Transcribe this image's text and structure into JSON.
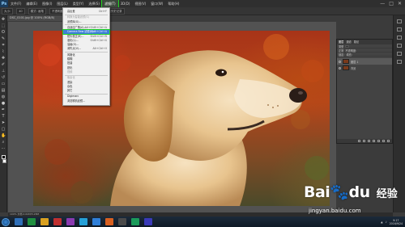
{
  "menubar": {
    "app_icon": "Ps",
    "items": [
      "文件(F)",
      "编辑(E)",
      "图像(I)",
      "图层(L)",
      "类型(Y)",
      "选择(S)",
      "滤镜(T)",
      "3D(D)",
      "视图(V)",
      "窗口(W)",
      "帮助(H)"
    ],
    "active_index": 6,
    "window_controls": [
      "—",
      "□",
      "✕"
    ]
  },
  "optbar": {
    "items": [
      "大小:",
      "40",
      "模式: 画笔",
      "不透明度: 100%",
      "流量: 100%",
      "抹到历史记录"
    ]
  },
  "doc_tab": "DSC_0101.jpg @ 100% (RGB/8)",
  "dropdown": {
    "items": [
      {
        "label": "高反差",
        "shortcut": "Ctrl+F",
        "disabled": false
      },
      {
        "label": "转换为智能滤镜(S)",
        "shortcut": "",
        "disabled": true
      },
      {
        "label": "滤镜库(G)...",
        "shortcut": "",
        "disabled": false
      },
      {
        "label": "自适应广角(A)...",
        "shortcut": "Alt+Shift+Ctrl+A",
        "disabled": false
      },
      {
        "label": "Camera Raw 滤镜(C)...",
        "shortcut": "Shift+Ctrl+A",
        "disabled": false
      },
      {
        "label": "镜头校正(R)...",
        "shortcut": "Shift+Ctrl+R",
        "disabled": false
      },
      {
        "label": "液化(L)...",
        "shortcut": "Shift+Ctrl+X",
        "disabled": false
      },
      {
        "label": "油画(O)...",
        "shortcut": "",
        "disabled": false
      },
      {
        "label": "消失点(V)...",
        "shortcut": "Alt+Ctrl+V",
        "disabled": false
      },
      {
        "label": "风格化",
        "shortcut": "",
        "disabled": false
      },
      {
        "label": "模糊",
        "shortcut": "",
        "disabled": false
      },
      {
        "label": "扭曲",
        "shortcut": "",
        "disabled": false
      },
      {
        "label": "锐化",
        "shortcut": "",
        "disabled": false
      },
      {
        "label": "视频",
        "shortcut": "",
        "disabled": true
      },
      {
        "label": "像素化",
        "shortcut": "",
        "disabled": true
      },
      {
        "label": "渲染",
        "shortcut": "",
        "disabled": false
      },
      {
        "label": "杂色",
        "shortcut": "",
        "disabled": false
      },
      {
        "label": "其它",
        "shortcut": "",
        "disabled": false
      },
      {
        "label": "Digimarc",
        "shortcut": "",
        "disabled": false
      },
      {
        "label": "浏览联机滤镜...",
        "shortcut": "",
        "disabled": false
      }
    ],
    "highlighted_index": 4
  },
  "layers_panel": {
    "tabs": [
      "图层",
      "通道",
      "路径"
    ],
    "kind_label": "类型",
    "blend_mode": "正常",
    "opacity_label": "不透明度:",
    "lock_label": "锁定:",
    "fill_label": "填充:",
    "layers": [
      "图层 1",
      "背景"
    ],
    "selected_index": 0
  },
  "status": "100%    文档:2.64M/5.28M",
  "taskbar": {
    "apps": [
      "#2f6fb8",
      "#1f8f3f",
      "#d8a020",
      "#c03030",
      "#8a3ab0",
      "#25a0d8",
      "#2f7fd8",
      "#d86020",
      "#4a4a4a",
      "#1a9a5a",
      "#3a3ab8"
    ],
    "clock_time": "9:17",
    "clock_date": "2016/9/24"
  },
  "watermark": {
    "logo": "Bai",
    "logo2": "du",
    "jingyan": "经验",
    "url": "jingyan.baidu.com"
  },
  "colors": {
    "highlight_outline": "#22d422",
    "menu_highlight": "#3f7fd8"
  }
}
